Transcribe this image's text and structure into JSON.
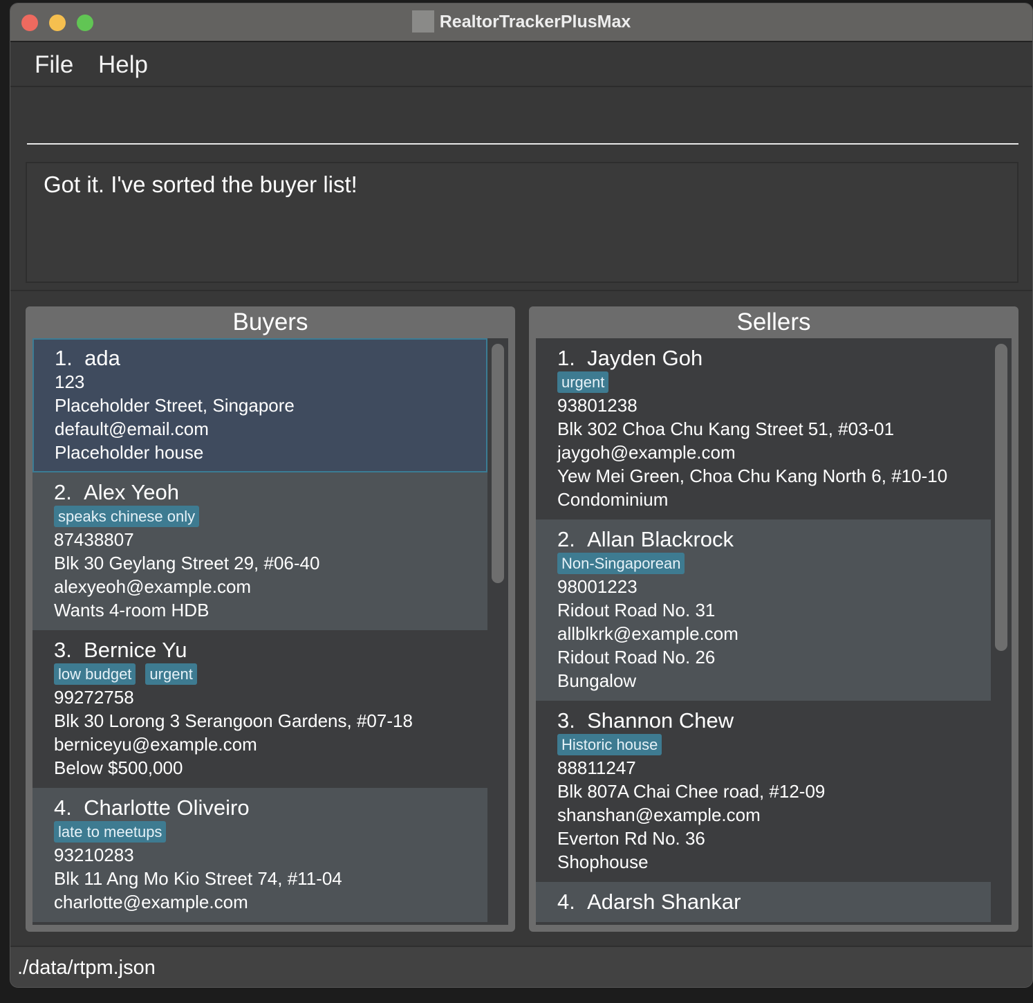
{
  "window": {
    "title": "RealtorTrackerPlusMax",
    "traffic_lights": {
      "close": "#ee6a5f",
      "minimize": "#f5bf4f",
      "maximize": "#61c554"
    }
  },
  "menu": {
    "file": "File",
    "help": "Help"
  },
  "command": {
    "value": "",
    "placeholder": ""
  },
  "result": {
    "text": "Got it. I've sorted the buyer list!"
  },
  "colors": {
    "tag": "#3e7b91",
    "selected": "#3f4b5e"
  },
  "buyers": {
    "title": "Buyers",
    "items": [
      {
        "index": "1.",
        "name": "ada",
        "tags": [],
        "lines": [
          "123",
          "Placeholder Street, Singapore",
          "default@email.com",
          "Placeholder house"
        ],
        "selected": true
      },
      {
        "index": "2.",
        "name": "Alex Yeoh",
        "tags": [
          "speaks chinese only"
        ],
        "lines": [
          "87438807",
          "Blk 30 Geylang Street 29, #06-40",
          "alexyeoh@example.com",
          "Wants 4-room HDB"
        ]
      },
      {
        "index": "3.",
        "name": "Bernice Yu",
        "tags": [
          "low budget",
          "urgent"
        ],
        "lines": [
          "99272758",
          "Blk 30 Lorong 3 Serangoon Gardens, #07-18",
          "berniceyu@example.com",
          "Below $500,000"
        ]
      },
      {
        "index": "4.",
        "name": "Charlotte Oliveiro",
        "tags": [
          "late to meetups"
        ],
        "lines": [
          "93210283",
          "Blk 11 Ang Mo Kio Street 74, #11-04",
          "charlotte@example.com"
        ]
      }
    ]
  },
  "sellers": {
    "title": "Sellers",
    "items": [
      {
        "index": "1.",
        "name": "Jayden Goh",
        "tags": [
          "urgent"
        ],
        "lines": [
          "93801238",
          "Blk 302 Choa Chu Kang Street 51, #03-01",
          "jaygoh@example.com",
          "Yew Mei Green, Choa Chu Kang North 6, #10-10",
          "Condominium"
        ]
      },
      {
        "index": "2.",
        "name": "Allan Blackrock",
        "tags": [
          "Non-Singaporean"
        ],
        "lines": [
          "98001223",
          "Ridout Road No. 31",
          "allblkrk@example.com",
          "Ridout Road No. 26",
          "Bungalow"
        ]
      },
      {
        "index": "3.",
        "name": "Shannon Chew",
        "tags": [
          "Historic house"
        ],
        "lines": [
          "88811247",
          "Blk 807A Chai Chee road, #12-09",
          "shanshan@example.com",
          "Everton Rd No. 36",
          "Shophouse"
        ]
      },
      {
        "index": "4.",
        "name": "Adarsh Shankar",
        "tags": [],
        "lines": []
      }
    ]
  },
  "status": {
    "path": "./data/rtpm.json"
  }
}
